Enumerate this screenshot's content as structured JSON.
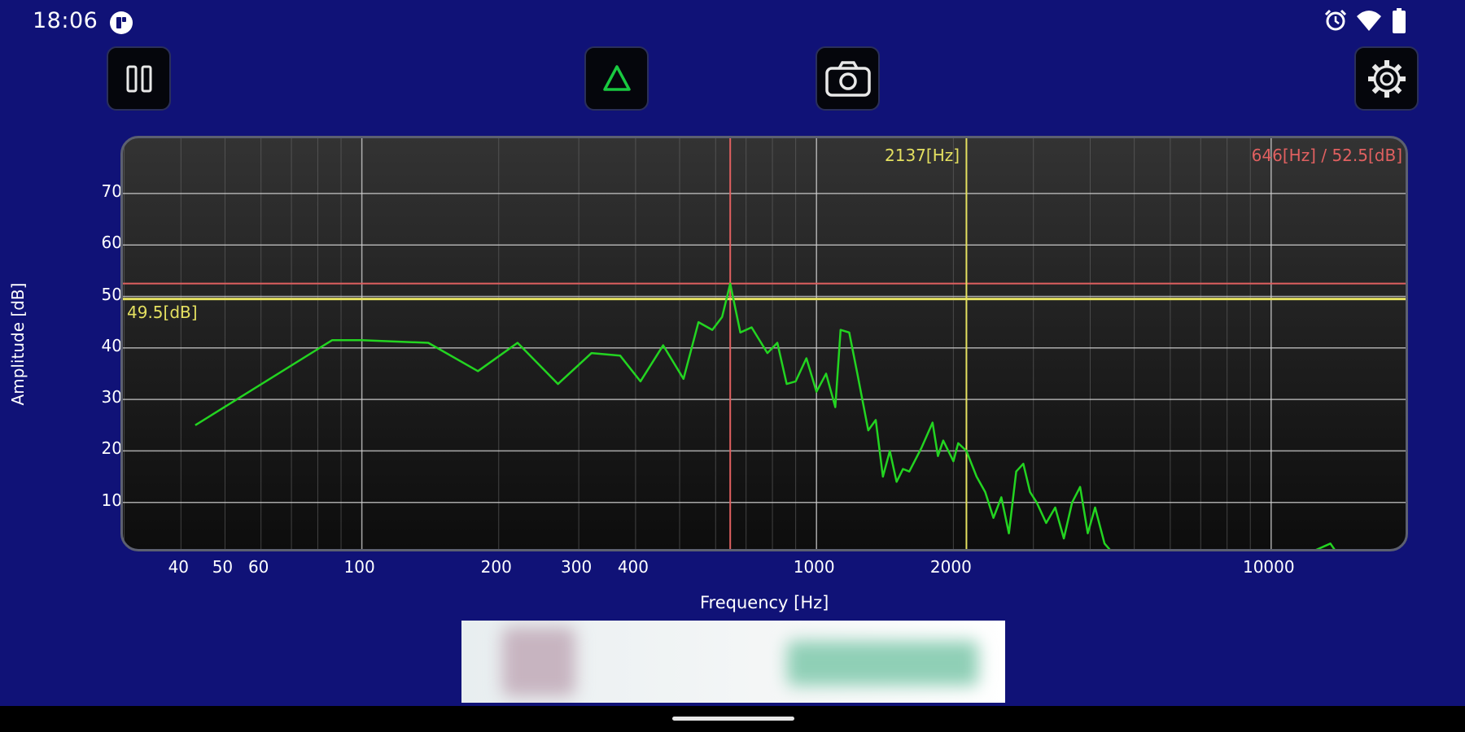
{
  "status_bar": {
    "time": "18:06",
    "app_icon": "app-notification-icon",
    "icons": [
      "alarm-icon",
      "wifi-icon",
      "battery-icon"
    ]
  },
  "toolbar": {
    "buttons": [
      {
        "name": "pause-button",
        "icon": "pause-icon"
      },
      {
        "name": "peak-hold-button",
        "icon": "triangle-icon",
        "accent": "#19c940"
      },
      {
        "name": "screenshot-button",
        "icon": "camera-icon"
      },
      {
        "name": "settings-button",
        "icon": "gear-icon"
      }
    ]
  },
  "colors": {
    "background": "#101277",
    "spectrum": "#23d421",
    "peak_marker": "#e06060",
    "cursor_marker": "#e4e060",
    "grid": "#d0d0d0"
  },
  "graph": {
    "y_axis_label": "Amplitude [dB]",
    "x_axis_label": "Frequency [Hz]",
    "y_ticks": [
      "70",
      "60",
      "50",
      "40",
      "30",
      "20",
      "10"
    ],
    "x_ticks": [
      "40",
      "50",
      "60",
      "100",
      "200",
      "300",
      "400",
      "1000",
      "2000",
      "10000"
    ],
    "cursor_frequency_label": "2137[Hz]",
    "peak_label": "646[Hz] / 52.5[dB]",
    "cursor_level_label": "49.5[dB]"
  },
  "chart_data": {
    "type": "line",
    "x_scale": "log",
    "xlim": [
      30,
      15000
    ],
    "ylim": [
      0,
      80
    ],
    "xlabel": "Frequency [Hz]",
    "ylabel": "Amplitude [dB]",
    "grid": true,
    "cursor": {
      "frequency": 2137,
      "level": 49.5
    },
    "peak": {
      "frequency": 646,
      "level": 52.5
    },
    "series": [
      {
        "x": [
          43,
          86,
          100,
          140,
          180,
          220,
          270,
          320,
          370,
          410,
          460,
          510,
          550,
          590,
          620,
          646,
          680,
          720,
          780,
          820,
          860,
          900,
          950,
          1000,
          1050,
          1100,
          1130,
          1180,
          1230,
          1300,
          1350,
          1400,
          1450,
          1500,
          1550,
          1600,
          1700,
          1800,
          1850,
          1900,
          2000,
          2050,
          2137,
          2250,
          2350,
          2450,
          2550,
          2650,
          2750,
          2850,
          2950,
          3050,
          3200,
          3350,
          3500,
          3650,
          3800,
          3950,
          4100,
          4300,
          4500,
          4700,
          5000,
          6000,
          8000,
          10000,
          12000,
          13500,
          14000,
          15000
        ],
        "y": [
          25,
          41.5,
          41.5,
          41,
          35.5,
          41,
          33,
          39,
          38.5,
          33.5,
          40.5,
          34,
          45,
          43.5,
          46,
          52.5,
          43,
          44,
          39,
          41,
          33,
          33.5,
          38,
          31.5,
          35,
          28.5,
          43.5,
          43,
          35,
          24,
          26,
          15,
          20,
          14,
          16.5,
          16,
          20.5,
          25.5,
          19,
          22,
          18,
          21.5,
          20,
          15,
          12,
          7,
          11,
          4,
          16,
          17.5,
          12,
          10,
          6,
          9,
          3,
          10,
          13,
          4,
          9,
          2,
          0,
          0,
          0,
          0,
          0,
          0,
          0,
          2,
          0,
          0
        ]
      }
    ]
  }
}
